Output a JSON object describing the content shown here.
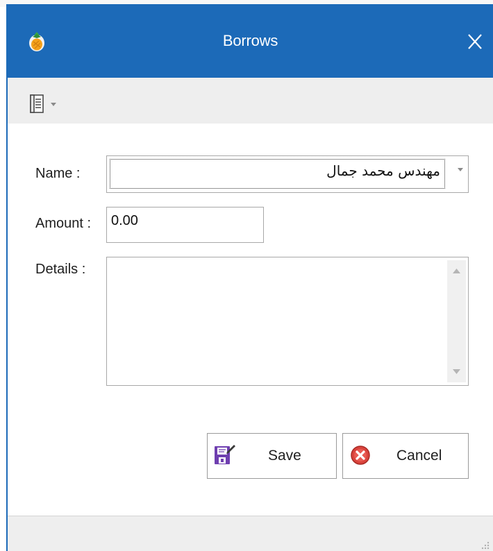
{
  "window": {
    "title": "Borrows",
    "close_glyph": "X",
    "app_icon": "pineapple-icon",
    "title_color": "#1c6ab8"
  },
  "toolbar": {
    "menu_icon": "document-list-icon",
    "menu_dropdown_icon": "chevron-down-icon"
  },
  "form": {
    "name_label": "Name :",
    "name_value": "مهندس محمد جمال",
    "amount_label": "Amount :",
    "amount_value": "0.00",
    "details_label": "Details :",
    "details_value": ""
  },
  "buttons": {
    "save_label": "Save",
    "save_icon": "save-disk-icon",
    "cancel_label": "Cancel",
    "cancel_icon": "cancel-x-circle-icon"
  }
}
